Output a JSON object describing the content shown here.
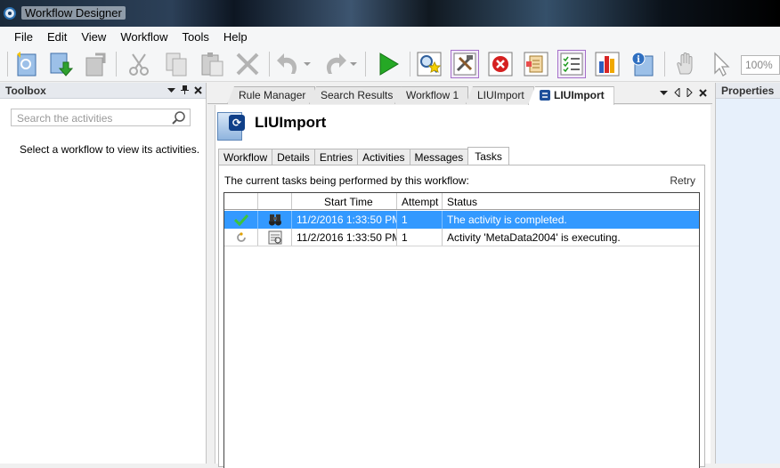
{
  "window": {
    "title": "Workflow Designer"
  },
  "menu": [
    "File",
    "Edit",
    "View",
    "Workflow",
    "Tools",
    "Help"
  ],
  "toolbar": {
    "zoom": "100%"
  },
  "toolbox": {
    "title": "Toolbox",
    "search_placeholder": "Search the activities",
    "message": "Select a workflow to view its activities."
  },
  "properties": {
    "title": "Properties"
  },
  "doc_tabs": [
    {
      "label": "Rule Manager"
    },
    {
      "label": "Search Results"
    },
    {
      "label": "Workflow 1"
    },
    {
      "label": "LIUImport"
    },
    {
      "label": "LIUImport"
    }
  ],
  "workflow": {
    "title": "LIUImport"
  },
  "sub_tabs": [
    "Workflow",
    "Details",
    "Entries",
    "Activities",
    "Messages",
    "Tasks"
  ],
  "tasks": {
    "caption": "The current tasks being performed by this workflow:",
    "retry": "Retry",
    "columns": [
      "",
      "",
      "Start Time",
      "Attempt",
      "Status"
    ],
    "rows": [
      {
        "start_time": "11/2/2016 1:33:50 PM",
        "attempt": "1",
        "status": "The activity is completed."
      },
      {
        "start_time": "11/2/2016 1:33:50 PM",
        "attempt": "1",
        "status": "Activity 'MetaData2004' is executing."
      }
    ]
  },
  "colors": {
    "selection": "#3399ff",
    "accent": "#a56fc9",
    "properties_bg": "#e7f0fb"
  },
  "icons": [
    "new-workflow-icon",
    "download-icon",
    "export-icon",
    "cut-icon",
    "copy-icon",
    "paste-icon",
    "delete-icon",
    "undo-icon",
    "redo-icon",
    "run-icon",
    "search-star-icon",
    "tools-icon",
    "stop-icon",
    "rules-icon",
    "checklist-icon",
    "report-chart-icon",
    "info-icon",
    "pan-hand-icon",
    "pointer-icon"
  ]
}
